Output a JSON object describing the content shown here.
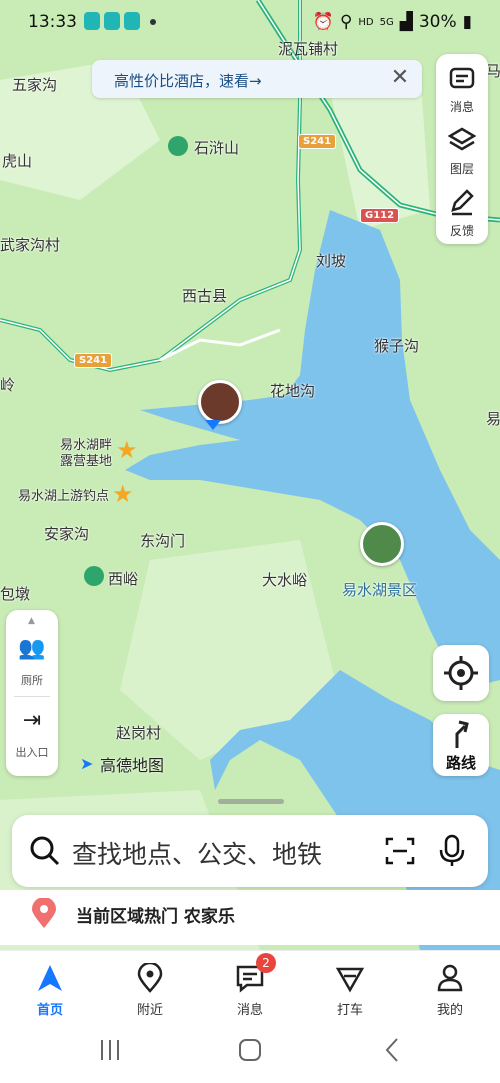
{
  "status_bar": {
    "time": "13:33",
    "network": "HD",
    "signal": "5G",
    "battery": "30%"
  },
  "promo": {
    "text": "高性价比酒店，速看→",
    "close": "✕"
  },
  "map": {
    "labels": {
      "nwapu": "泥瓦铺村",
      "wujiagou": "五家沟",
      "hushan": "虎山",
      "shixushan": "石浒山",
      "wujiagoucun": "武家沟村",
      "liupo": "刘坡",
      "xiguxian": "西古县",
      "houzigou": "猴子沟",
      "huadigou": "花地沟",
      "ling": "岭",
      "yi_right": "易",
      "yishuihupan": "易水湖畔",
      "luying": "露营基地",
      "shangyou": "易水湖上游钓点",
      "anjiagou": "安家沟",
      "dongkoumen": "东沟门",
      "xiyu": "西峪",
      "dashuiyu": "大水峪",
      "scenic": "易水湖景区",
      "dun": "包墩",
      "zhaogangcun": "赵岗村",
      "ma": "马"
    },
    "roads": {
      "s241a": "S241",
      "s241b": "S241",
      "g112": "G112"
    },
    "brand": "高德地图"
  },
  "right_tools": {
    "messages": "消息",
    "layers": "图层",
    "feedback": "反馈"
  },
  "left_tools": {
    "toilet": "厕所",
    "exit": "出入口"
  },
  "route_button": "路线",
  "search": {
    "placeholder": "查找地点、公交、地铁"
  },
  "hot": {
    "text": "当前区域热门 农家乐"
  },
  "nav": {
    "tabs": [
      {
        "label": "首页"
      },
      {
        "label": "附近"
      },
      {
        "label": "消息"
      },
      {
        "label": "打车"
      },
      {
        "label": "我的"
      }
    ],
    "message_badge": "2"
  },
  "colors": {
    "accent": "#1677ff",
    "water": "#7ec3ec",
    "land": "#c9ecb6",
    "badge": "#e8453c"
  }
}
